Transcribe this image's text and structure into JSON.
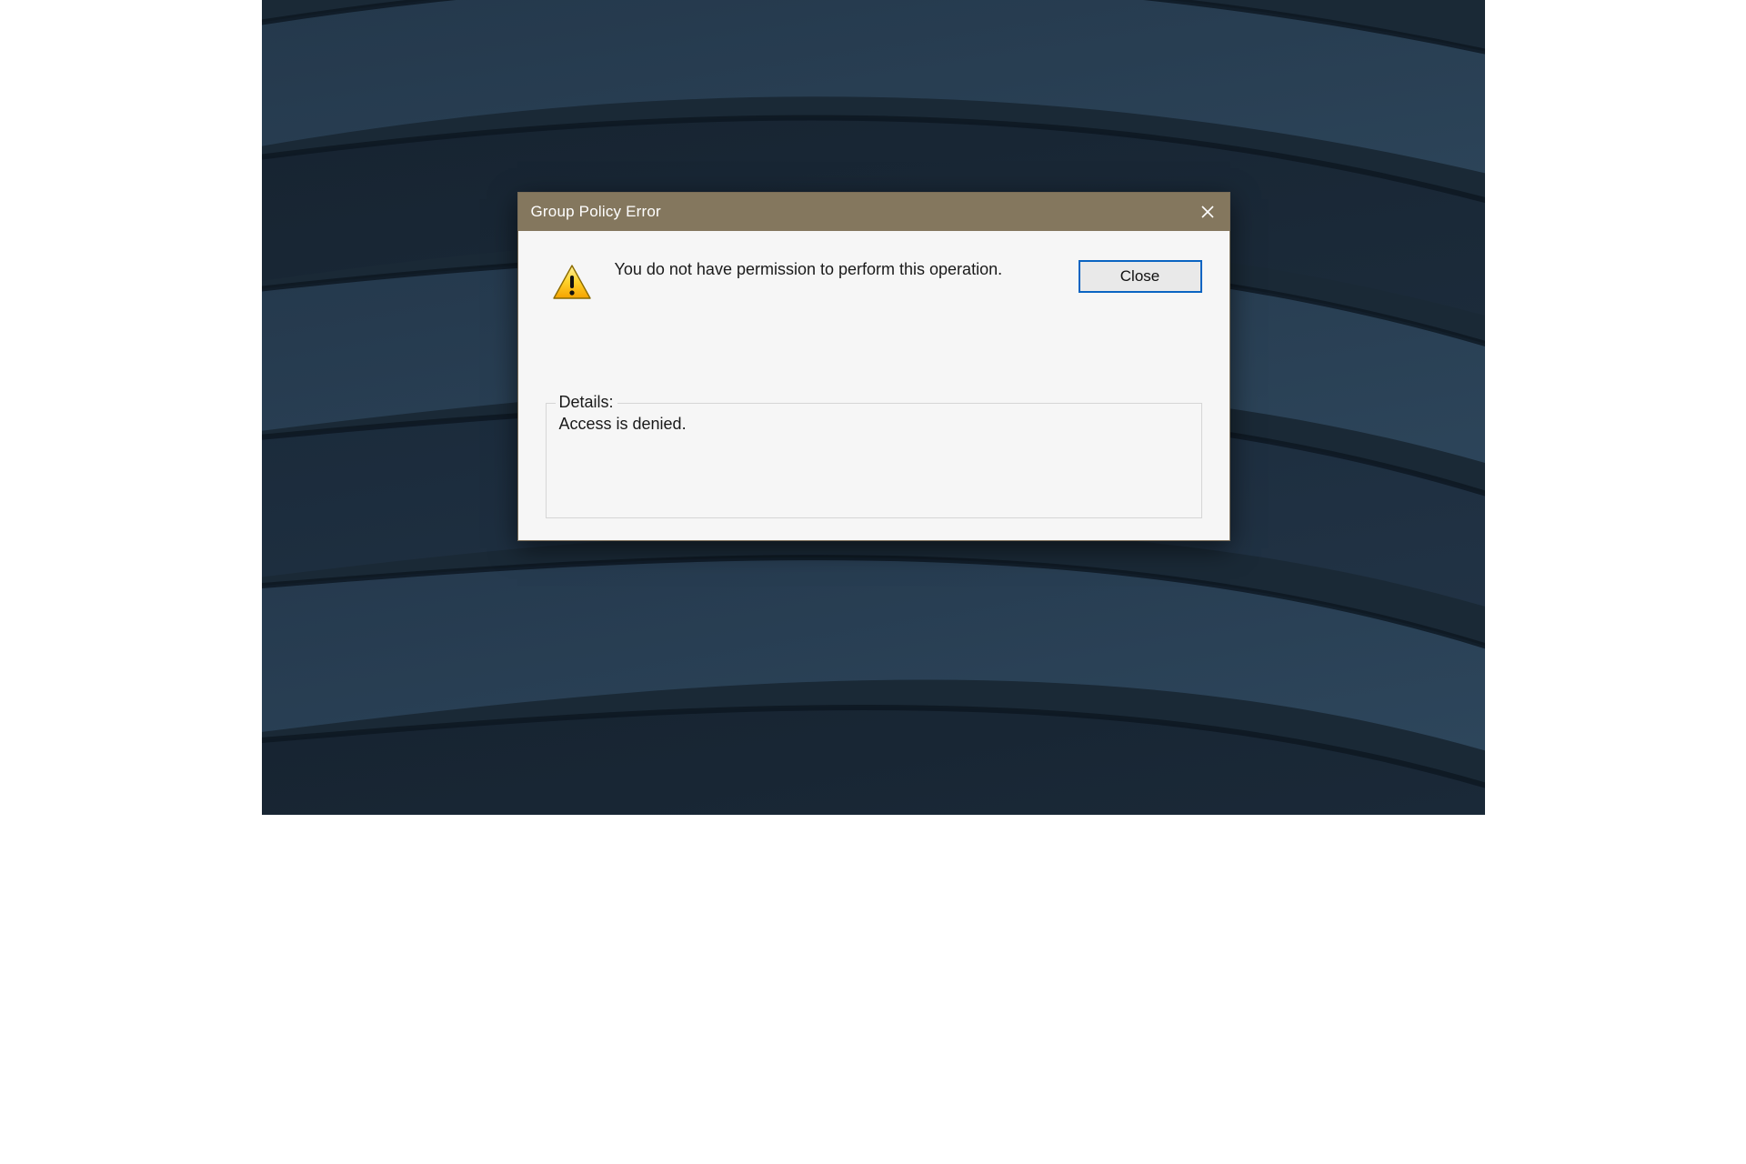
{
  "dialog": {
    "title": "Group Policy Error",
    "message": "You do not have permission to perform this operation.",
    "close_btn_label": "Close",
    "details_label": "Details:",
    "details_text": "Access is denied."
  }
}
